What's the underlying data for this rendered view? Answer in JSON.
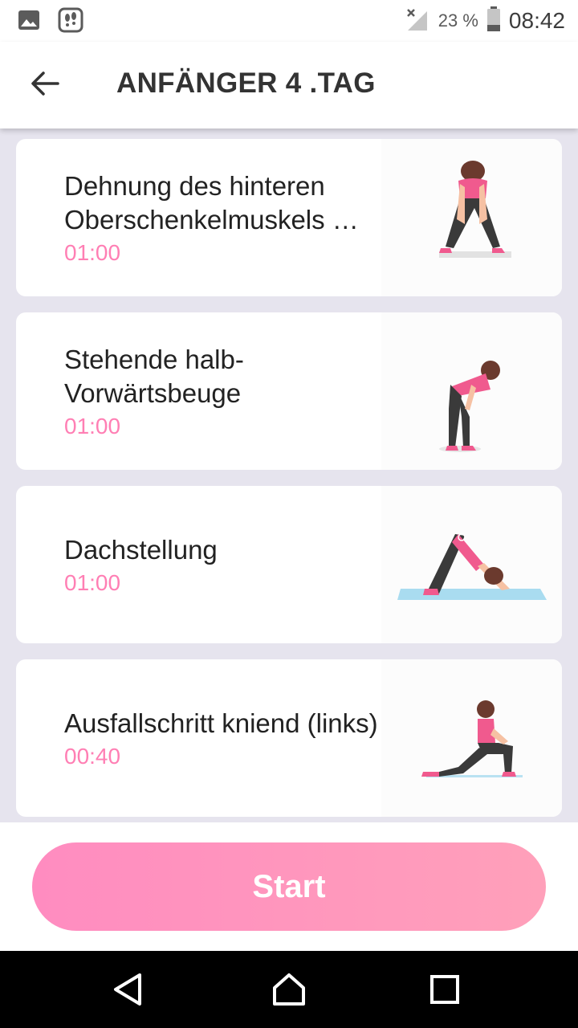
{
  "status_bar": {
    "battery_percent": "23 %",
    "time": "08:42"
  },
  "header": {
    "title": "ANFÄNGER 4 .TAG"
  },
  "exercises": [
    {
      "name": "Dehnung des hinteren Oberschenkelmuskels …",
      "duration": "01:00",
      "image": "forward-fold-stretch"
    },
    {
      "name": "Stehende halb-Vorwärtsbeuge",
      "duration": "01:00",
      "image": "standing-half-forward-bend"
    },
    {
      "name": "Dachstellung",
      "duration": "01:00",
      "image": "downward-dog-on-mat"
    },
    {
      "name": "Ausfallschritt kniend (links)",
      "duration": "00:40",
      "image": "kneeling-lunge"
    }
  ],
  "start_button": {
    "label": "Start"
  },
  "colors": {
    "accent_pink": "#ff7fb4",
    "button_gradient_start": "#ff8cc0",
    "button_gradient_end": "#ffa0ba",
    "list_background": "#e6e4ee"
  }
}
